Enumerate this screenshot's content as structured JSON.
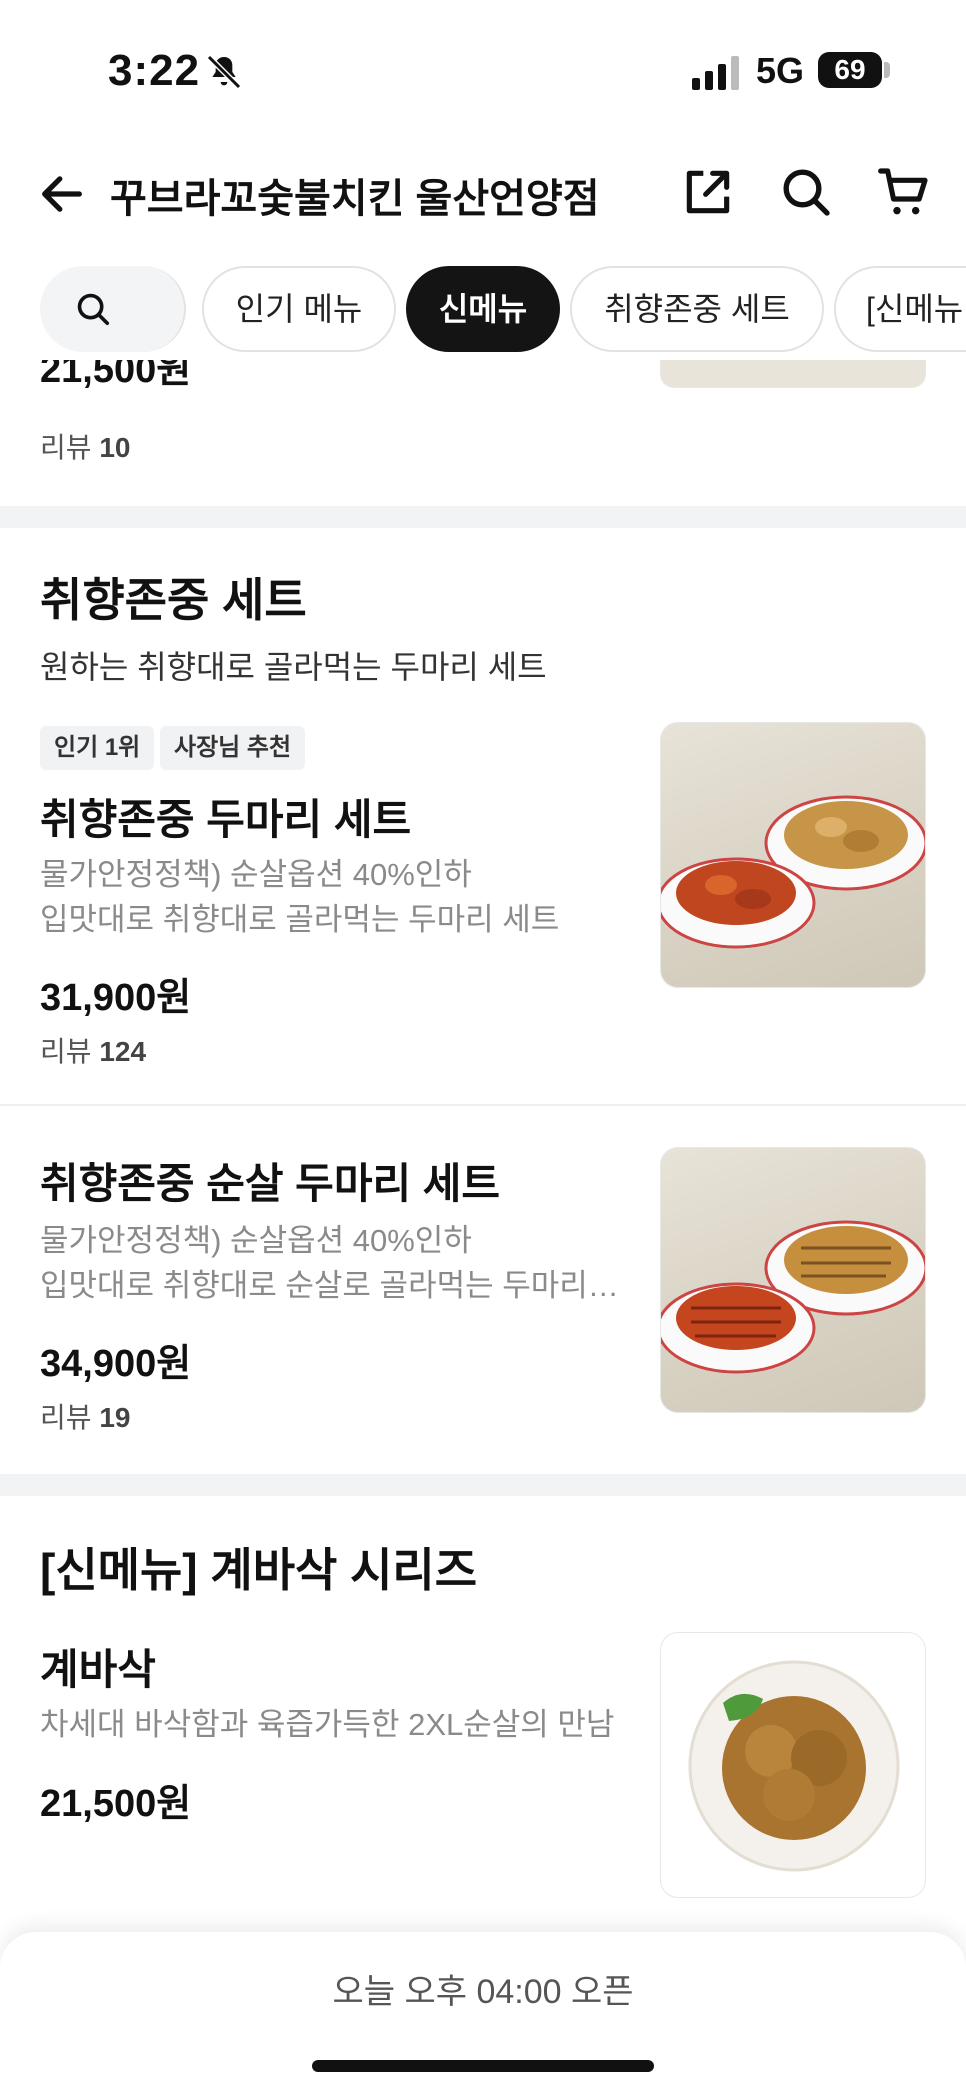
{
  "status": {
    "time": "3:22",
    "network": "5G",
    "battery": "69"
  },
  "header": {
    "title": "꾸브라꼬숯불치킨 울산언양점"
  },
  "chips": [
    "인기 메뉴",
    "신메뉴",
    "취향존중 세트",
    "[신메뉴"
  ],
  "active_chip": "신메뉴",
  "prev_item": {
    "price": "21,500원",
    "review_label": "리뷰",
    "review_count": "10"
  },
  "sections": [
    {
      "title": "취향존중 세트",
      "subtitle": "원하는 취향대로 골라먹는 두마리 세트",
      "items": [
        {
          "badges": [
            "인기 1위",
            "사장님 추천"
          ],
          "name": "취향존중 두마리 세트",
          "desc1": "물가안정정책) 순살옵션 40%인하",
          "desc2": "입맛대로 취향대로 골라먹는 두마리 세트",
          "price": "31,900원",
          "review_label": "리뷰",
          "review_count": "124"
        },
        {
          "name": "취향존중 순살 두마리 세트",
          "desc1": "물가안정정책) 순살옵션 40%인하",
          "desc2": "입맛대로 취향대로 순살로 골라먹는 두마리…",
          "price": "34,900원",
          "review_label": "리뷰",
          "review_count": "19"
        }
      ]
    },
    {
      "title": "[신메뉴] 계바삭 시리즈",
      "items": [
        {
          "name": "계바삭",
          "desc1": "차세대 바삭함과 육즙가득한 2XL순살의 만남",
          "price": "21,500원"
        }
      ]
    }
  ],
  "bottom": {
    "open_text": "오늘 오후 04:00 오픈"
  },
  "colors": {
    "active_chip_bg": "#141414",
    "divider": "#f2f3f5",
    "desc_text": "#8a8a8a"
  }
}
